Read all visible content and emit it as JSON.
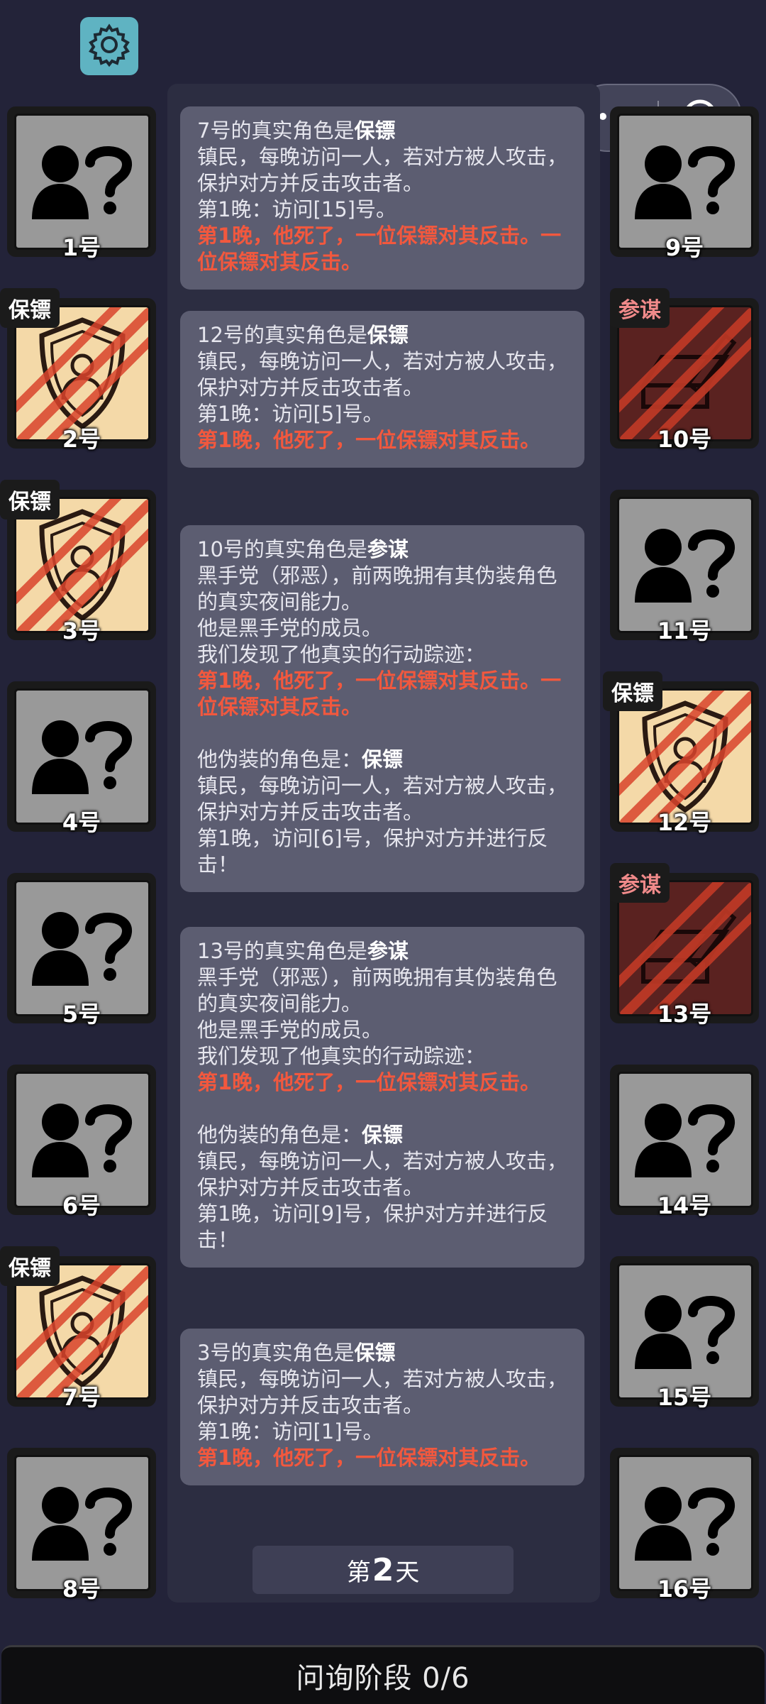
{
  "ui": {
    "settings_icon": "gear-icon",
    "capsule": {
      "more_icon": "more-dots-icon",
      "close_icon": "target-circle-icon"
    }
  },
  "colors": {
    "background": "#232339",
    "unknown_card": "#999999",
    "guard_card": "#f4d9a8",
    "plotter_card": "#5a2220",
    "highlight_red": "#f2583e"
  },
  "players": [
    {
      "num": "1号",
      "role_tag": "",
      "type": "unknown"
    },
    {
      "num": "2号",
      "role_tag": "保镖",
      "type": "guard"
    },
    {
      "num": "3号",
      "role_tag": "保镖",
      "type": "guard"
    },
    {
      "num": "4号",
      "role_tag": "",
      "type": "unknown"
    },
    {
      "num": "5号",
      "role_tag": "",
      "type": "unknown"
    },
    {
      "num": "6号",
      "role_tag": "",
      "type": "unknown"
    },
    {
      "num": "7号",
      "role_tag": "保镖",
      "type": "guard"
    },
    {
      "num": "8号",
      "role_tag": "",
      "type": "unknown"
    },
    {
      "num": "9号",
      "role_tag": "",
      "type": "unknown"
    },
    {
      "num": "10号",
      "role_tag": "参谋",
      "type": "plotter"
    },
    {
      "num": "11号",
      "role_tag": "",
      "type": "unknown"
    },
    {
      "num": "12号",
      "role_tag": "保镖",
      "type": "guard"
    },
    {
      "num": "13号",
      "role_tag": "参谋",
      "type": "plotter"
    },
    {
      "num": "14号",
      "role_tag": "",
      "type": "unknown"
    },
    {
      "num": "15号",
      "role_tag": "",
      "type": "unknown"
    },
    {
      "num": "16号",
      "role_tag": "",
      "type": "unknown"
    }
  ],
  "log": [
    {
      "title_prefix": "7号的真实角色是",
      "title_role": "保镖",
      "lines": [
        {
          "text": "镇民，每晚访问一人，若对方被人攻击，保护对方并反击攻击者。",
          "style": "normal"
        },
        {
          "text": "第1晚：访问[15]号。",
          "style": "normal"
        },
        {
          "text": "第1晚，他死了，一位保镖对其反击。一位保镖对其反击。",
          "style": "red"
        }
      ]
    },
    {
      "title_prefix": "12号的真实角色是",
      "title_role": "保镖",
      "lines": [
        {
          "text": "镇民，每晚访问一人，若对方被人攻击，保护对方并反击攻击者。",
          "style": "normal"
        },
        {
          "text": "第1晚：访问[5]号。",
          "style": "normal"
        },
        {
          "text": "第1晚，他死了，一位保镖对其反击。",
          "style": "red"
        }
      ]
    },
    {
      "title_prefix": "10号的真实角色是",
      "title_role": "参谋",
      "lines": [
        {
          "text": "黑手党（邪恶），前两晚拥有其伪装角色的真实夜间能力。",
          "style": "normal"
        },
        {
          "text": "他是黑手党的成员。",
          "style": "normal"
        },
        {
          "text": "我们发现了他真实的行动踪迹：",
          "style": "normal"
        },
        {
          "text": "第1晚，他死了，一位保镖对其反击。一位保镖对其反击。",
          "style": "red"
        },
        {
          "text": "",
          "style": "gap"
        },
        {
          "text": "他伪装的角色是：",
          "style": "normal",
          "bold_suffix": "保镖"
        },
        {
          "text": "镇民，每晚访问一人，若对方被人攻击，保护对方并反击攻击者。",
          "style": "normal"
        },
        {
          "text": "第1晚，访问[6]号，保护对方并进行反击！",
          "style": "normal"
        }
      ]
    },
    {
      "title_prefix": "13号的真实角色是",
      "title_role": "参谋",
      "lines": [
        {
          "text": "黑手党（邪恶），前两晚拥有其伪装角色的真实夜间能力。",
          "style": "normal"
        },
        {
          "text": "他是黑手党的成员。",
          "style": "normal"
        },
        {
          "text": "我们发现了他真实的行动踪迹：",
          "style": "normal"
        },
        {
          "text": "第1晚，他死了，一位保镖对其反击。",
          "style": "red"
        },
        {
          "text": "",
          "style": "gap"
        },
        {
          "text": "他伪装的角色是：",
          "style": "normal",
          "bold_suffix": "保镖"
        },
        {
          "text": "镇民，每晚访问一人，若对方被人攻击，保护对方并反击攻击者。",
          "style": "normal"
        },
        {
          "text": "第1晚，访问[9]号，保护对方并进行反击！",
          "style": "normal"
        }
      ]
    },
    {
      "title_prefix": "3号的真实角色是",
      "title_role": "保镖",
      "lines": [
        {
          "text": "镇民，每晚访问一人，若对方被人攻击，保护对方并反击攻击者。",
          "style": "normal"
        },
        {
          "text": "第1晚：访问[1]号。",
          "style": "normal"
        },
        {
          "text": "第1晚，他死了，一位保镖对其反击。",
          "style": "red"
        }
      ]
    }
  ],
  "day": {
    "prefix": "第",
    "number": "2",
    "suffix": "天"
  },
  "phase": {
    "label": "问询阶段 0/6"
  }
}
